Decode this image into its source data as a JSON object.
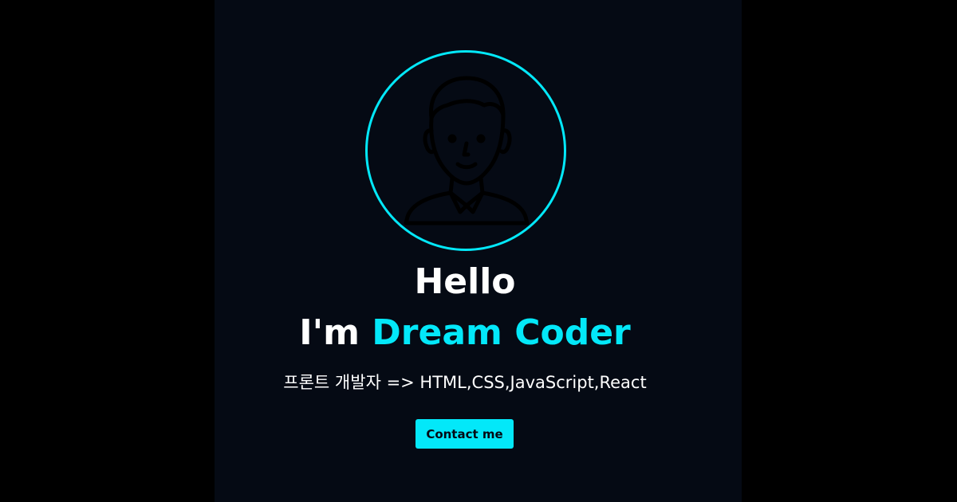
{
  "home": {
    "avatar_icon": "person-outline-icon",
    "greeting": "Hello",
    "intro_prefix": "I'm ",
    "name": "Dream Coder",
    "description": "프론트 개발자 => HTML,CSS,JavaScript,React",
    "contact_button_label": "Contact me"
  },
  "colors": {
    "background": "#050a14",
    "outer_background": "#000000",
    "accent": "#03e8f9",
    "text": "#ffffff"
  }
}
